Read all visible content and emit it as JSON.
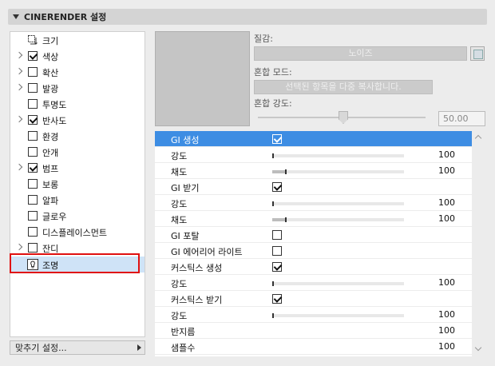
{
  "header": {
    "title": "CINERENDER 설정"
  },
  "tree": [
    {
      "label": "크기",
      "expandable": false,
      "checkbox": false,
      "icon": "resize-icon"
    },
    {
      "label": "색상",
      "expandable": true,
      "checkbox": true,
      "checked": true
    },
    {
      "label": "확산",
      "expandable": true,
      "checkbox": true,
      "checked": false
    },
    {
      "label": "발광",
      "expandable": true,
      "checkbox": true,
      "checked": false
    },
    {
      "label": "투명도",
      "expandable": false,
      "checkbox": true,
      "checked": false
    },
    {
      "label": "반사도",
      "expandable": true,
      "checkbox": true,
      "checked": true
    },
    {
      "label": "환경",
      "expandable": false,
      "checkbox": true,
      "checked": false
    },
    {
      "label": "안개",
      "expandable": false,
      "checkbox": true,
      "checked": false
    },
    {
      "label": "범프",
      "expandable": true,
      "checkbox": true,
      "checked": true
    },
    {
      "label": "보롱",
      "expandable": false,
      "checkbox": true,
      "checked": false
    },
    {
      "label": "알파",
      "expandable": false,
      "checkbox": true,
      "checked": false
    },
    {
      "label": "글로우",
      "expandable": false,
      "checkbox": true,
      "checked": false
    },
    {
      "label": "디스플레이스먼트",
      "expandable": false,
      "checkbox": true,
      "checked": false
    },
    {
      "label": "잔디",
      "expandable": true,
      "checkbox": true,
      "checked": false
    },
    {
      "label": "조명",
      "expandable": false,
      "checkbox": false,
      "icon": "light-bulb-icon",
      "selected": true
    }
  ],
  "footer": {
    "label": "맞추기 설정..."
  },
  "props": {
    "texture_label": "질감:",
    "texture_value": "노이즈",
    "blend_mode_label": "혼합 모드:",
    "blend_mode_value": "선택된 항목을 다중 복사합니다.",
    "blend_strength_label": "혼합 강도:",
    "blend_strength_value": "50.00",
    "blend_strength_fraction": 0.5
  },
  "rows": [
    {
      "label": "GI 생성",
      "type": "checkbox",
      "checked": true,
      "highlight": true
    },
    {
      "label": "강도",
      "type": "slider",
      "level": 0.0,
      "value": "100"
    },
    {
      "label": "채도",
      "type": "slider",
      "level": 0.1,
      "value": "100"
    },
    {
      "label": "GI 받기",
      "type": "checkbox",
      "checked": true
    },
    {
      "label": "강도",
      "type": "slider",
      "level": 0.0,
      "value": "100"
    },
    {
      "label": "채도",
      "type": "slider",
      "level": 0.1,
      "value": "100"
    },
    {
      "label": "GI 포탈",
      "type": "checkbox",
      "checked": false
    },
    {
      "label": "GI 에어리어 라이트",
      "type": "checkbox",
      "checked": false
    },
    {
      "label": "커스틱스 생성",
      "type": "checkbox",
      "checked": true
    },
    {
      "label": "강도",
      "type": "slider",
      "level": 0.0,
      "value": "100"
    },
    {
      "label": "커스틱스 받기",
      "type": "checkbox",
      "checked": true
    },
    {
      "label": "강도",
      "type": "slider",
      "level": 0.0,
      "value": "100"
    },
    {
      "label": "반지름",
      "type": "value",
      "value": "100"
    },
    {
      "label": "샘플수",
      "type": "value",
      "value": "100"
    }
  ]
}
